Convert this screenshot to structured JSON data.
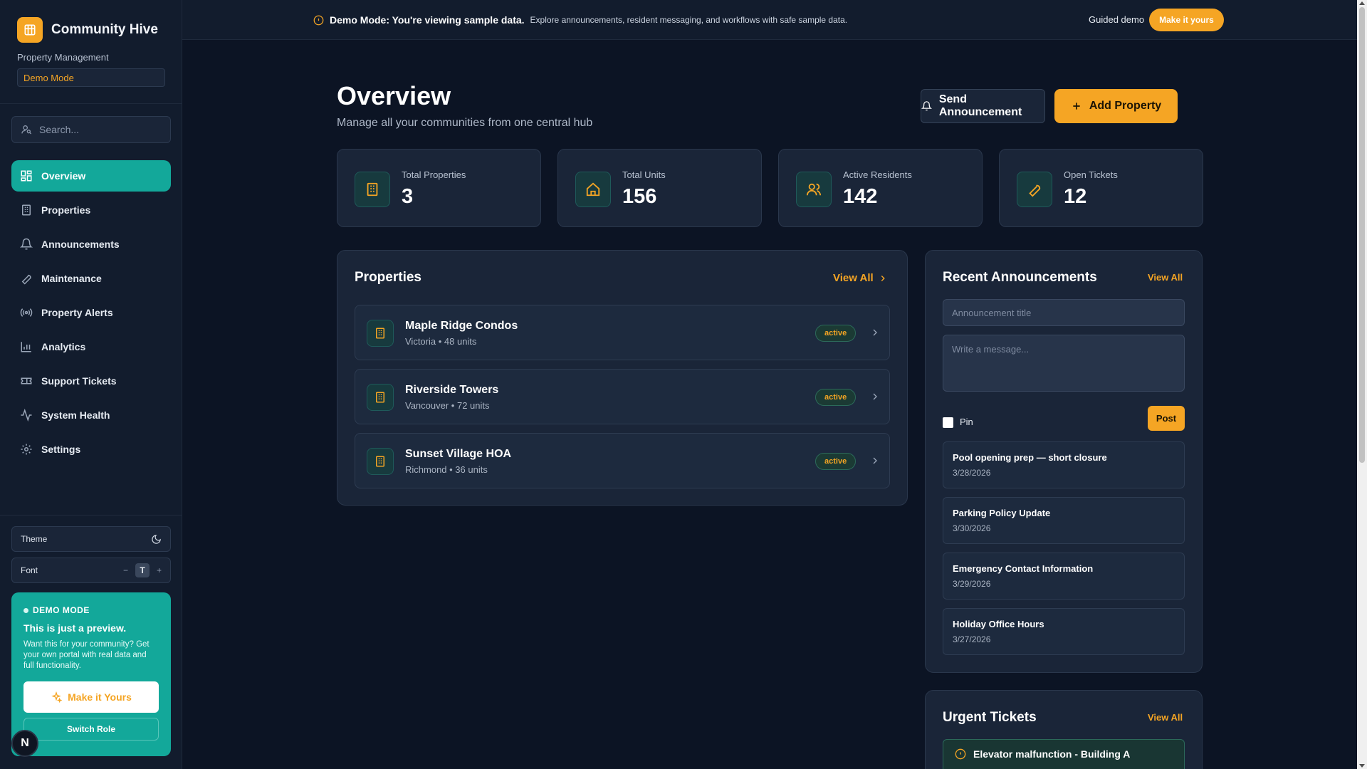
{
  "brand": {
    "name": "Community Hive",
    "subtitle": "Property Management",
    "mode_chip": "Demo Mode"
  },
  "search": {
    "placeholder": "Search..."
  },
  "nav": [
    {
      "label": "Overview",
      "icon": "grid-icon",
      "active": true
    },
    {
      "label": "Properties",
      "icon": "building-icon"
    },
    {
      "label": "Announcements",
      "icon": "bell-icon"
    },
    {
      "label": "Maintenance",
      "icon": "wrench-icon"
    },
    {
      "label": "Property Alerts",
      "icon": "broadcast-icon"
    },
    {
      "label": "Analytics",
      "icon": "bar-chart-icon"
    },
    {
      "label": "Support Tickets",
      "icon": "ticket-icon"
    },
    {
      "label": "System Health",
      "icon": "activity-icon"
    },
    {
      "label": "Settings",
      "icon": "gear-icon"
    }
  ],
  "prefs": {
    "theme_label": "Theme",
    "font_label": "Font",
    "font_decrease": "−",
    "font_glyph": "T",
    "font_increase": "+"
  },
  "demo_card": {
    "tag": "DEMO MODE",
    "title": "This is just a preview.",
    "text": "Want this for your community? Get your own portal with real data and full functionality.",
    "cta": "Make it Yours",
    "switch": "Switch Role"
  },
  "avatar": {
    "initial": "N"
  },
  "banner": {
    "bold": "Demo Mode: You're viewing sample data.",
    "text": "Explore announcements, resident messaging, and workflows with safe sample data.",
    "guided": "Guided demo",
    "cta": "Make it yours"
  },
  "page": {
    "title": "Overview",
    "subtitle": "Manage all your communities from one central hub",
    "send_announcement": "Send Announcement",
    "add_property": "Add Property"
  },
  "stats": [
    {
      "label": "Total Properties",
      "value": "3",
      "icon": "building-icon"
    },
    {
      "label": "Total Units",
      "value": "156",
      "icon": "home-icon"
    },
    {
      "label": "Active Residents",
      "value": "142",
      "icon": "users-icon"
    },
    {
      "label": "Open Tickets",
      "value": "12",
      "icon": "wrench-icon"
    }
  ],
  "properties": {
    "title": "Properties",
    "view_all": "View All",
    "items": [
      {
        "name": "Maple Ridge Condos",
        "meta": "Victoria • 48 units",
        "status": "active"
      },
      {
        "name": "Riverside Towers",
        "meta": "Vancouver • 72 units",
        "status": "active"
      },
      {
        "name": "Sunset Village HOA",
        "meta": "Richmond • 36 units",
        "status": "active"
      }
    ]
  },
  "announcements": {
    "title": "Recent Announcements",
    "view_all": "View All",
    "title_placeholder": "Announcement title",
    "message_placeholder": "Write a message...",
    "pin_label": "Pin",
    "post": "Post",
    "items": [
      {
        "title": "Pool opening prep — short closure",
        "date": "3/28/2026"
      },
      {
        "title": "Parking Policy Update",
        "date": "3/30/2026"
      },
      {
        "title": "Emergency Contact Information",
        "date": "3/29/2026"
      },
      {
        "title": "Holiday Office Hours",
        "date": "3/27/2026"
      }
    ]
  },
  "urgent": {
    "title": "Urgent Tickets",
    "view_all": "View All",
    "items": [
      {
        "title": "Elevator malfunction - Building A"
      }
    ]
  },
  "colors": {
    "accent": "#f5a524",
    "teal": "#13a89a",
    "background": "#0c1424",
    "panel": "#1a2538"
  }
}
